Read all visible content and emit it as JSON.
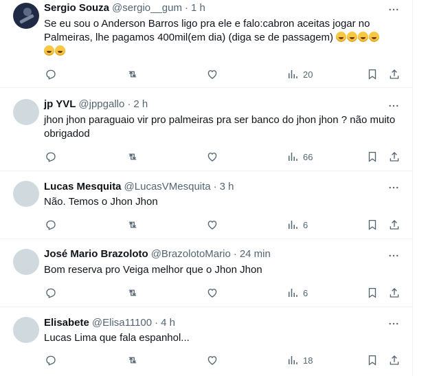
{
  "tweets": [
    {
      "name": "Sergio Souza",
      "handle": "@sergio__gum",
      "time": "1 h",
      "text": "Se eu sou o Anderson Barros ligo pra ele e falo:cabron aceitas jogar no Palmeiras, lhe pagamos 400mil(em dia) (diga se de passagem)",
      "emoji_count": 6,
      "views": "20",
      "avatar": "photo"
    },
    {
      "name": "jp YVL",
      "handle": "@jppgallo",
      "time": "2 h",
      "text": "jhon jhon paraguaio vir pro palmeiras pra ser banco do jhon jhon ? não muito obrigadod",
      "views": "66",
      "avatar": "default"
    },
    {
      "name": "Lucas Mesquita",
      "handle": "@LucasVMesquita",
      "time": "3 h",
      "text": "Não. Temos o Jhon Jhon",
      "views": "6",
      "avatar": "default"
    },
    {
      "name": "José Mario Brazoloto",
      "handle": "@BrazolotoMario",
      "time": "24 min",
      "text": "Bom reserva pro Veiga melhor que o Jhon Jhon",
      "views": "6",
      "avatar": "default"
    },
    {
      "name": "Elisabete",
      "handle": "@Elisa11100",
      "time": "4 h",
      "text": "Lucas Lima que fala espanhol...",
      "views": "18",
      "avatar": "default"
    }
  ],
  "separator": "·",
  "icons": {
    "reply": "reply-icon",
    "retweet": "retweet-icon",
    "like": "like-icon",
    "views": "views-icon",
    "bookmark": "bookmark-icon",
    "share": "share-icon",
    "more": "more-icon"
  },
  "colors": {
    "text": "#0f1419",
    "secondary": "#536471",
    "avatar_placeholder": "#cfd9de",
    "divider": "#eff3f4"
  }
}
